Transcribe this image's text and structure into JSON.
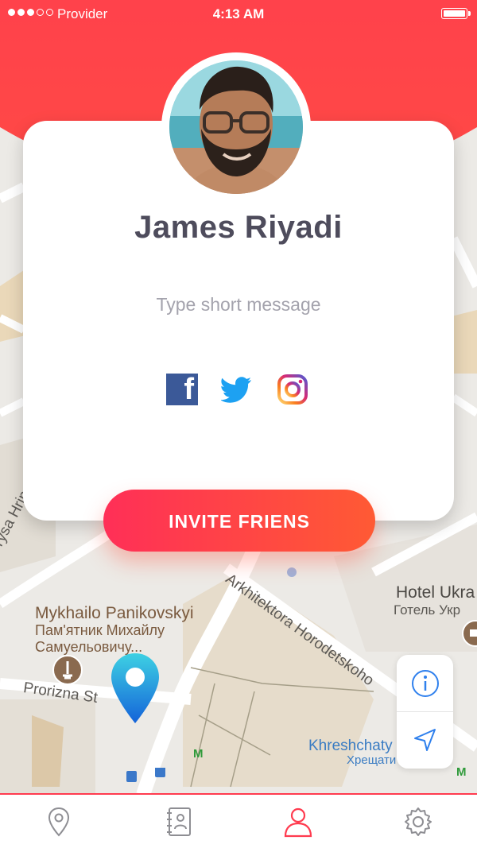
{
  "status_bar": {
    "carrier": "Provider",
    "time": "4:13 AM",
    "signal_dots_filled": 3,
    "signal_dots_total": 5
  },
  "profile": {
    "name": "James Riyadi",
    "message_placeholder": "Type short message"
  },
  "socials": [
    {
      "name": "facebook",
      "icon": "facebook-icon"
    },
    {
      "name": "twitter",
      "icon": "twitter-icon"
    },
    {
      "name": "instagram",
      "icon": "instagram-icon"
    }
  ],
  "invite_button": {
    "label": "INVITE FRIENS"
  },
  "map": {
    "labels": {
      "borysa": "Borysa Hrin",
      "arkhitektora": "Arkhitektora Horodetskoho",
      "hotel_en": "Hotel Ukra",
      "hotel_ua": "Готель Укр",
      "mykhailo_en": "Mykhailo Panikovskyi",
      "mykhailo_ua1": "Пам'ятник Михайлу",
      "mykhailo_ua2": "Самуельовичу...",
      "prorizna": "Prorizna St",
      "khreshchatyk_en": "Khreshchaty",
      "khreshchatyk_ua": "Хрещати"
    },
    "metro": "M"
  },
  "map_controls": [
    {
      "icon": "info-icon"
    },
    {
      "icon": "navigate-arrow-icon"
    }
  ],
  "tabbar": [
    {
      "icon": "location-pin-icon",
      "active": false
    },
    {
      "icon": "contacts-book-icon",
      "active": false
    },
    {
      "icon": "profile-user-icon",
      "active": true
    },
    {
      "icon": "settings-gear-icon",
      "active": false
    }
  ],
  "colors": {
    "accent_red": "#ff3b4f",
    "gradient_start": "#ff2f57",
    "gradient_end": "#ff5a34",
    "name_text": "#4e4c5c",
    "tab_inactive": "#8e8e93",
    "control_blue": "#2f80ed"
  }
}
